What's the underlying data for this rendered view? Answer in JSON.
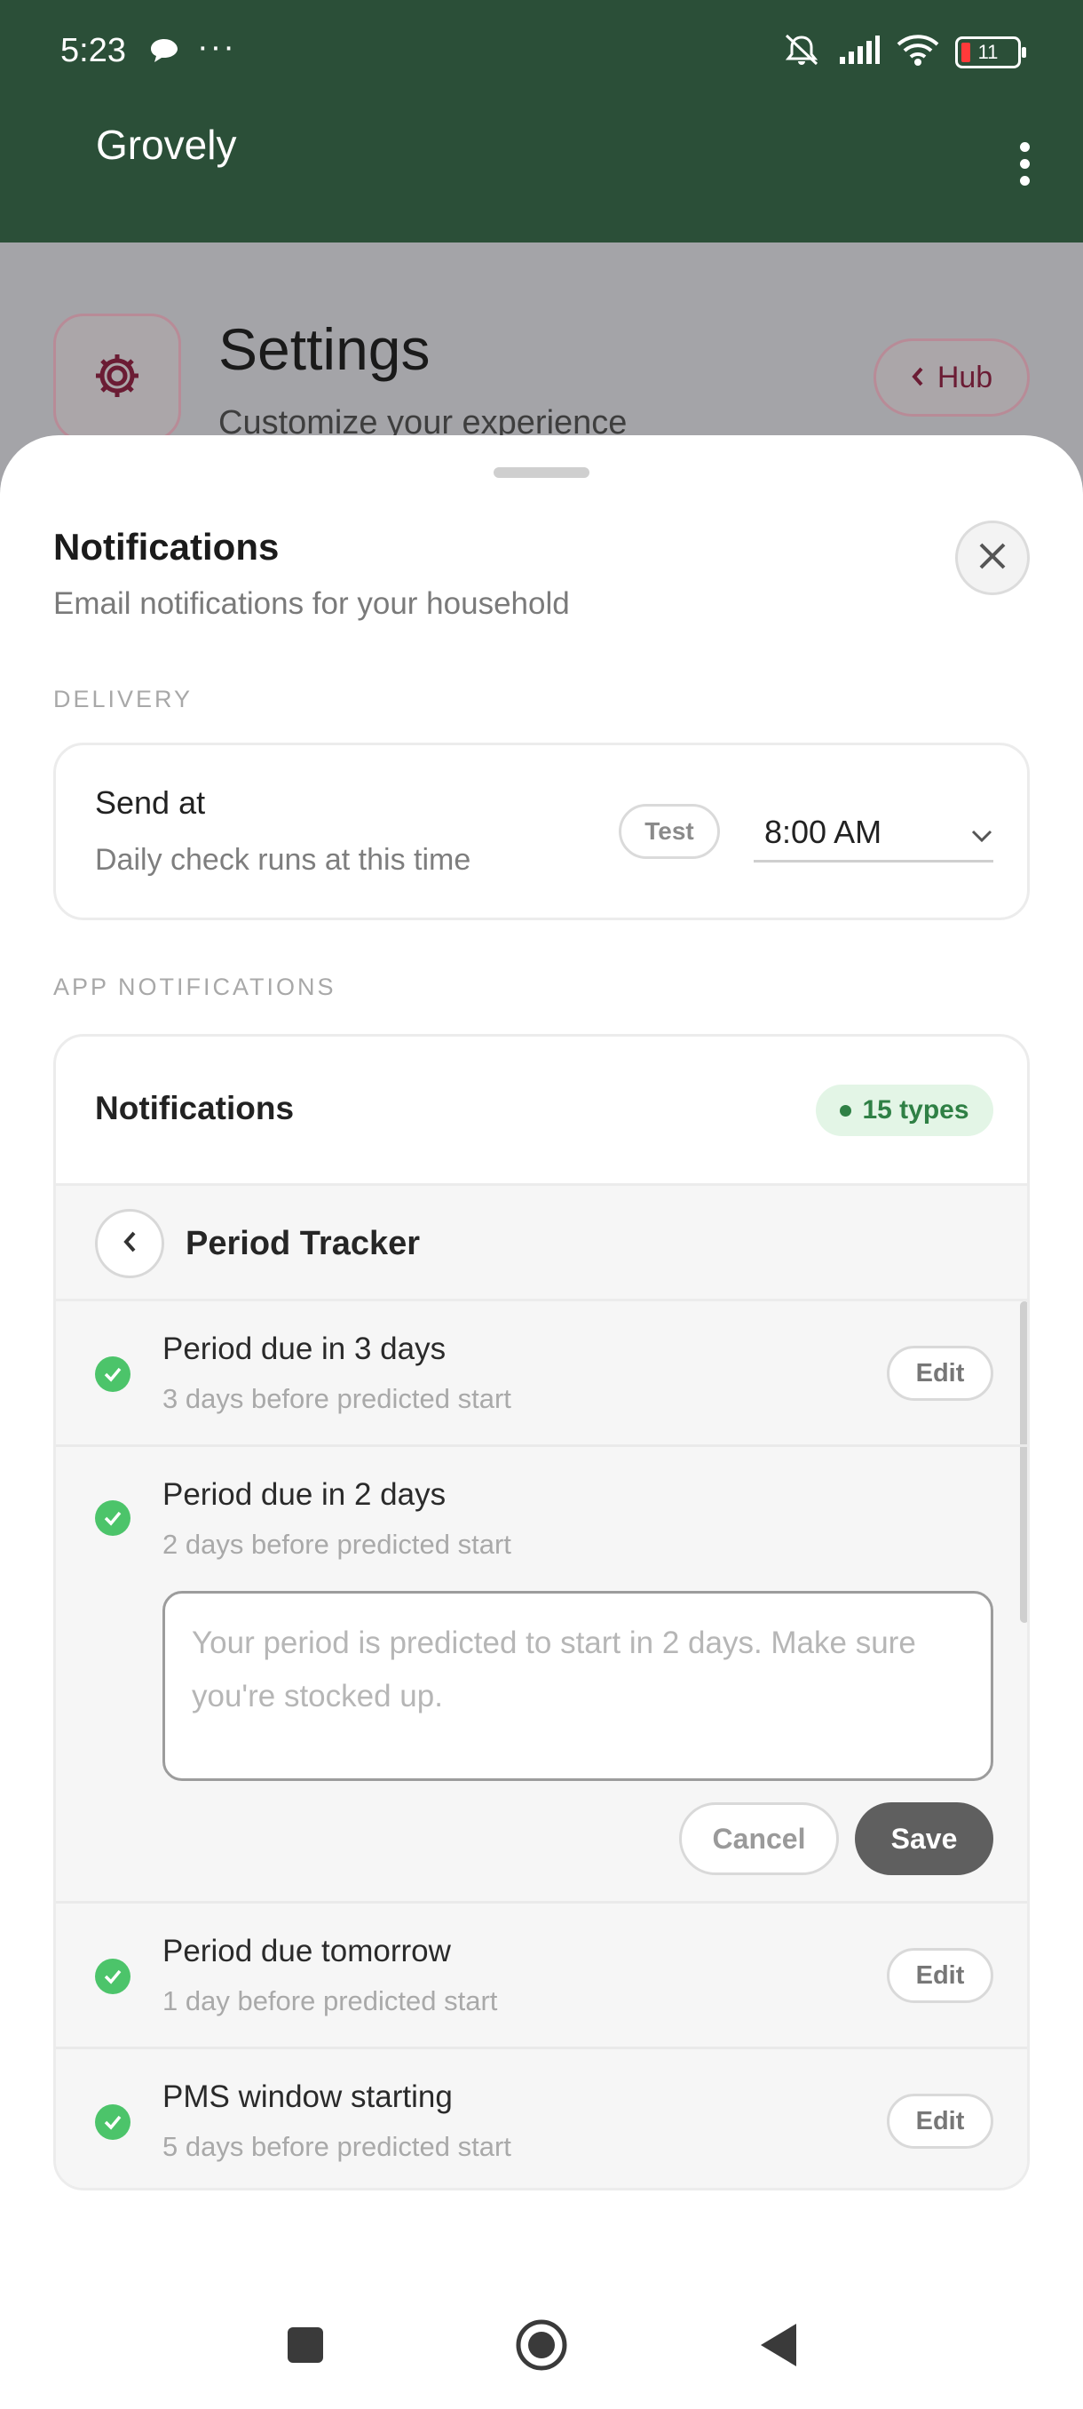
{
  "status_bar": {
    "time": "5:23",
    "battery": "11"
  },
  "app_bar": {
    "title": "Grovely"
  },
  "background_page": {
    "title": "Settings",
    "subtitle": "Customize your experience",
    "hub_label": "Hub"
  },
  "sheet": {
    "title": "Notifications",
    "subtitle": "Email notifications for your household",
    "delivery": {
      "section_label": "DELIVERY",
      "send_at_label": "Send at",
      "send_at_sub": "Daily check runs at this time",
      "test_label": "Test",
      "time_value": "8:00 AM"
    },
    "app_notifications": {
      "section_label": "APP NOTIFICATIONS",
      "header_title": "Notifications",
      "types_badge": "15 types",
      "category_title": "Period Tracker",
      "items": [
        {
          "title": "Period due in 3 days",
          "subtitle": "3 days before predicted start",
          "edit_label": "Edit"
        },
        {
          "title": "Period due in 2 days",
          "subtitle": "2 days before predicted start",
          "editor_placeholder": "Your period is predicted to start in 2 days. Make sure you're stocked up.",
          "cancel_label": "Cancel",
          "save_label": "Save"
        },
        {
          "title": "Period due tomorrow",
          "subtitle": "1 day before predicted start",
          "edit_label": "Edit"
        },
        {
          "title": "PMS window starting",
          "subtitle": "5 days before predicted start",
          "edit_label": "Edit"
        }
      ]
    }
  },
  "colors": {
    "app_bar": "#2b4f38",
    "accent_green": "#4cc46a",
    "badge_green": "#2f8045",
    "brand_maroon": "#6b1c34"
  }
}
